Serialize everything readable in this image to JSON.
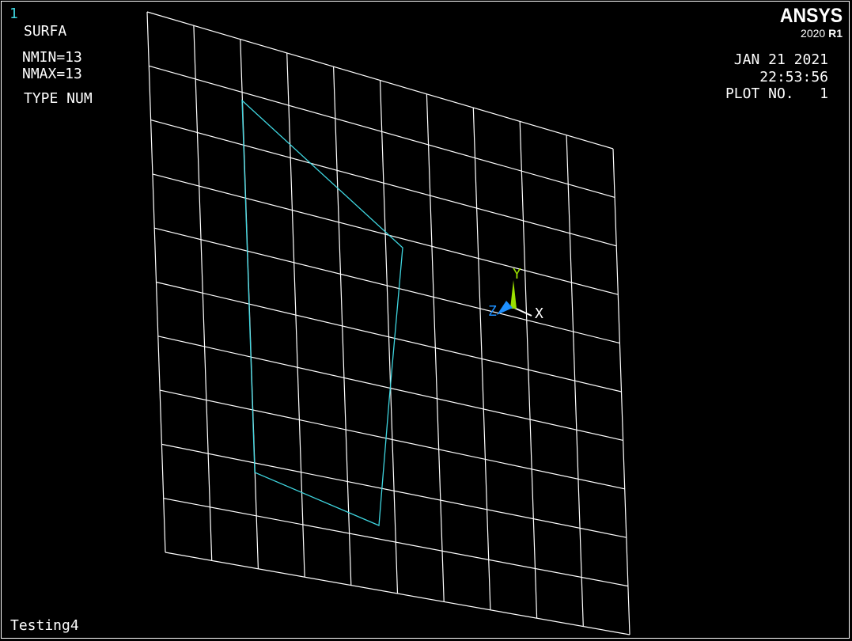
{
  "window": {
    "number": "1",
    "command": "SURFA",
    "nmin": "NMIN=13",
    "nmax": "NMAX=13",
    "type": "TYPE NUM",
    "title": "Testing4"
  },
  "logo": {
    "name": "ANSYS",
    "year": "2020",
    "release": "R1"
  },
  "stamp": {
    "date": "JAN 21 2021",
    "time": "22:53:56",
    "plot": "PLOT NO.   1"
  },
  "triad": {
    "x_label": "X",
    "y_label": "Y",
    "z_label": "Z"
  },
  "colors": {
    "background": "#000000",
    "mesh": "#ffffff",
    "area_outline": "#3fd6e0",
    "axis_x": "#ffffff",
    "axis_y": "#9be000",
    "axis_z": "#1e90ff"
  },
  "mesh": {
    "divisions_u": 10,
    "divisions_v": 10
  }
}
